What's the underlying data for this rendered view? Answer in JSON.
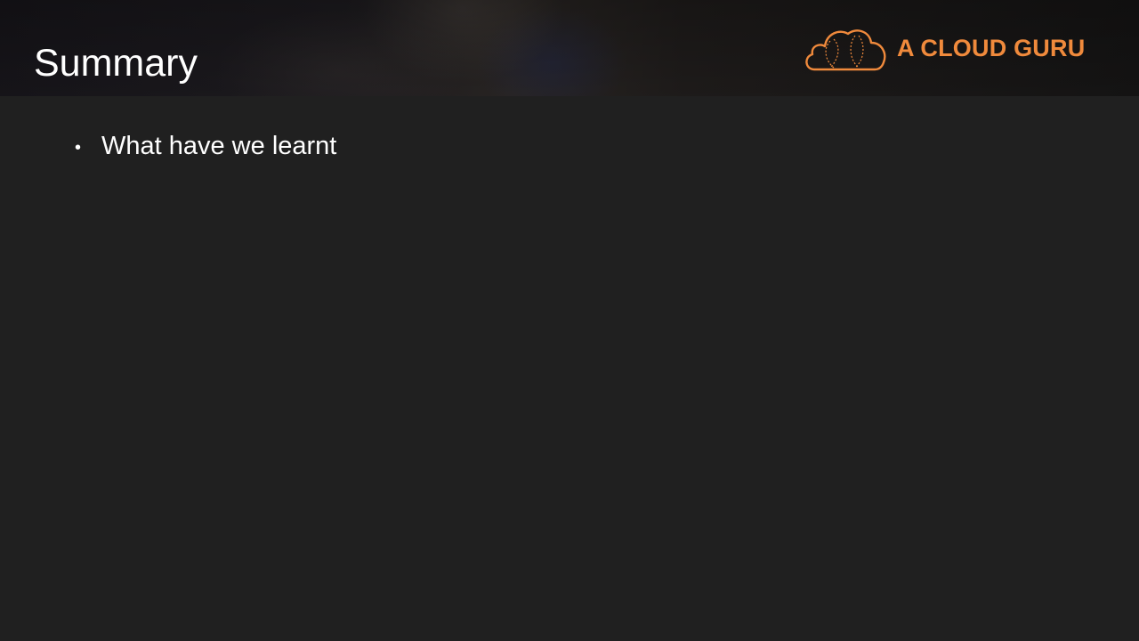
{
  "slide": {
    "title": "Summary",
    "brand": {
      "name": "A CLOUD GURU",
      "color": "#f08a3c",
      "icon": "cloud-logo-icon"
    },
    "bullets": [
      {
        "marker": "•",
        "text": "What have we learnt"
      }
    ]
  },
  "colors": {
    "background": "#202020",
    "text": "#ffffff",
    "accent": "#f08a3c"
  }
}
